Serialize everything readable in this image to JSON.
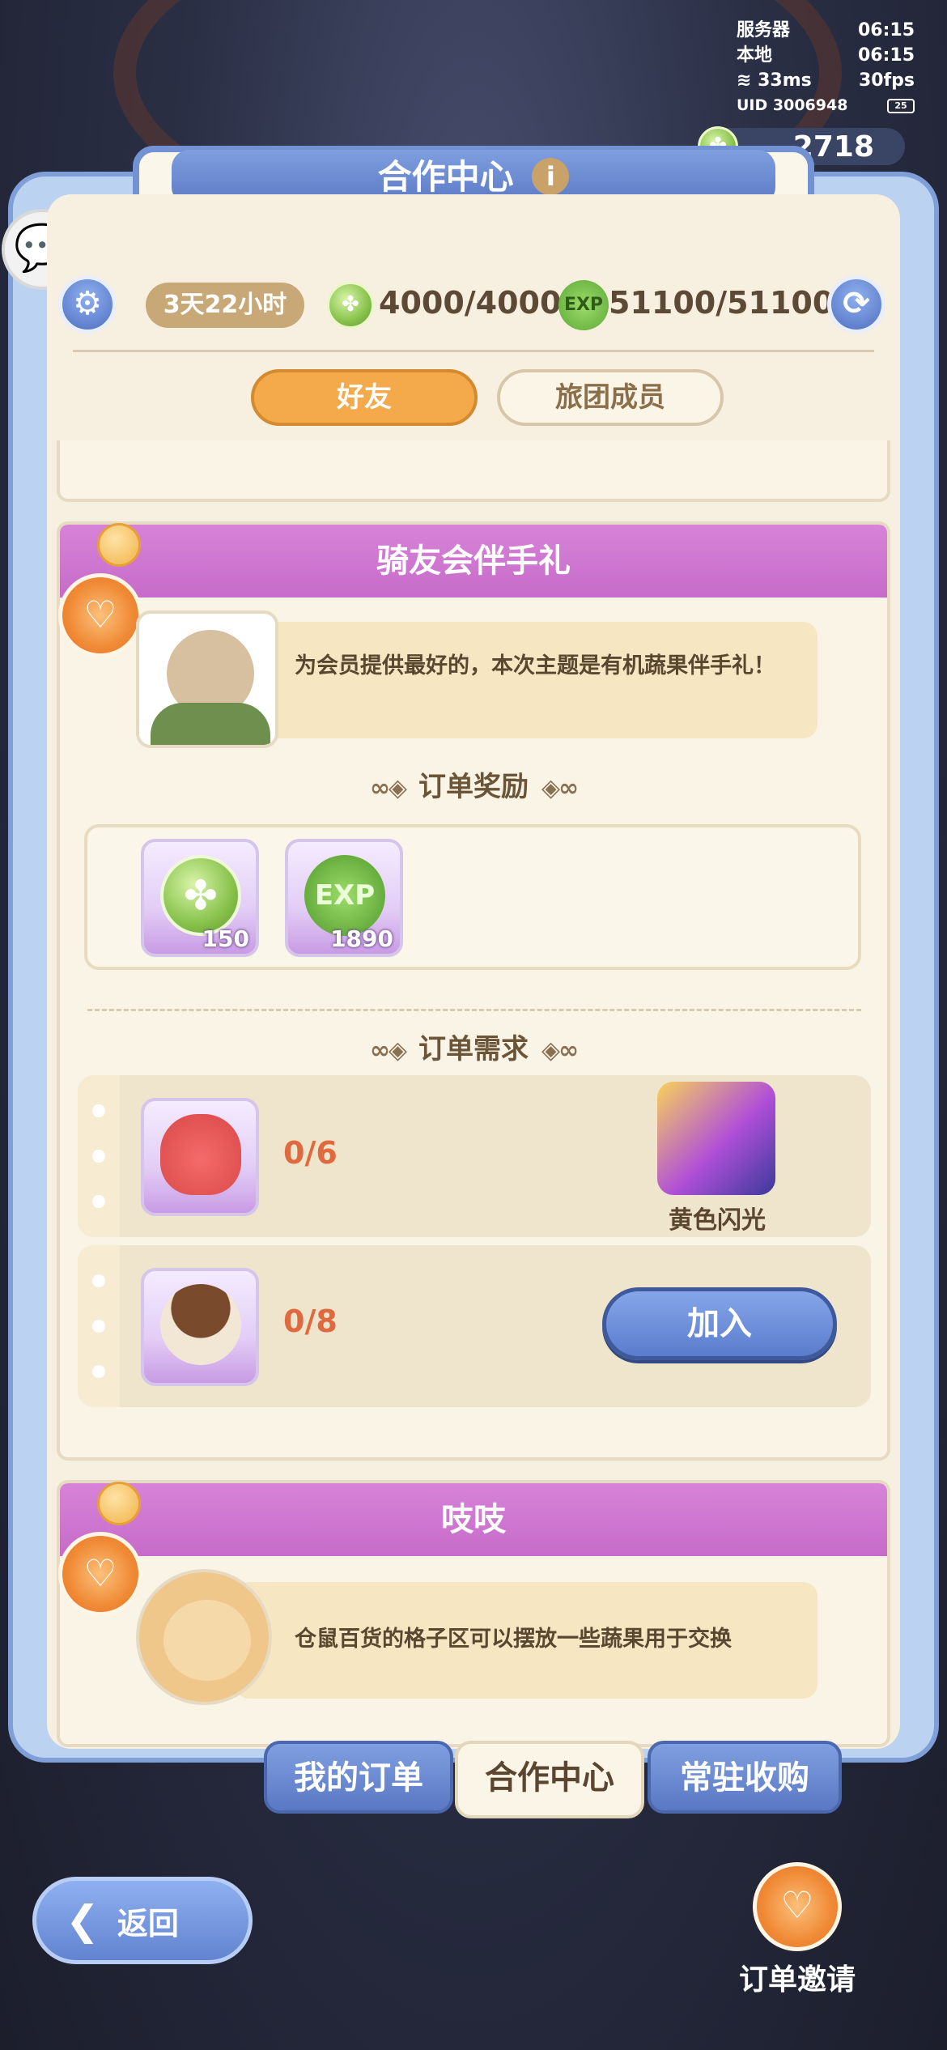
{
  "status": {
    "server_label": "服务器",
    "server_time": "06:15",
    "local_label": "本地",
    "local_time": "06:15",
    "ping": "33ms",
    "fps": "30fps",
    "uid": "UID 3006948",
    "battery": "25"
  },
  "currency": {
    "amount": "2718"
  },
  "window": {
    "title": "合作中心",
    "info_icon": "i"
  },
  "resources": {
    "timer": "3天22小时",
    "clover_value": "4000/4000",
    "exp_label": "EXP",
    "exp_value": "51100/51100"
  },
  "tabs": [
    {
      "label": "好友",
      "active": true
    },
    {
      "label": "旅团成员",
      "active": false
    }
  ],
  "order_card": {
    "title": "骑友会伴手礼",
    "description": "为会员提供最好的，本次主题是有机蔬果伴手礼！",
    "reward_section": "订单奖励",
    "rewards": [
      {
        "icon": "clover-coin-icon",
        "count": "150"
      },
      {
        "icon": "exp-clover-icon",
        "count": "1890"
      }
    ],
    "requirement_section": "订单需求",
    "requirements": [
      {
        "icon": "strawberry-item-icon",
        "progress": "0/6",
        "side_label": "黄色闪光"
      },
      {
        "icon": "mushroom-item-icon",
        "progress": "0/8",
        "button": "加入"
      }
    ]
  },
  "second_card": {
    "title": "吱吱",
    "description": "仓鼠百货的格子区可以摆放一些蔬果用于交换"
  },
  "bottom_tabs": [
    {
      "label": "我的订单",
      "active": false
    },
    {
      "label": "合作中心",
      "active": true
    },
    {
      "label": "常驻收购",
      "active": false
    }
  ],
  "back_button": "返回",
  "invite_label": "订单邀请",
  "colors": {
    "panel_blue": "#7e9fd8",
    "header_purple": "#c66bc9",
    "active_tab_orange": "#f4a94a",
    "progress_red": "#e06a3f"
  }
}
